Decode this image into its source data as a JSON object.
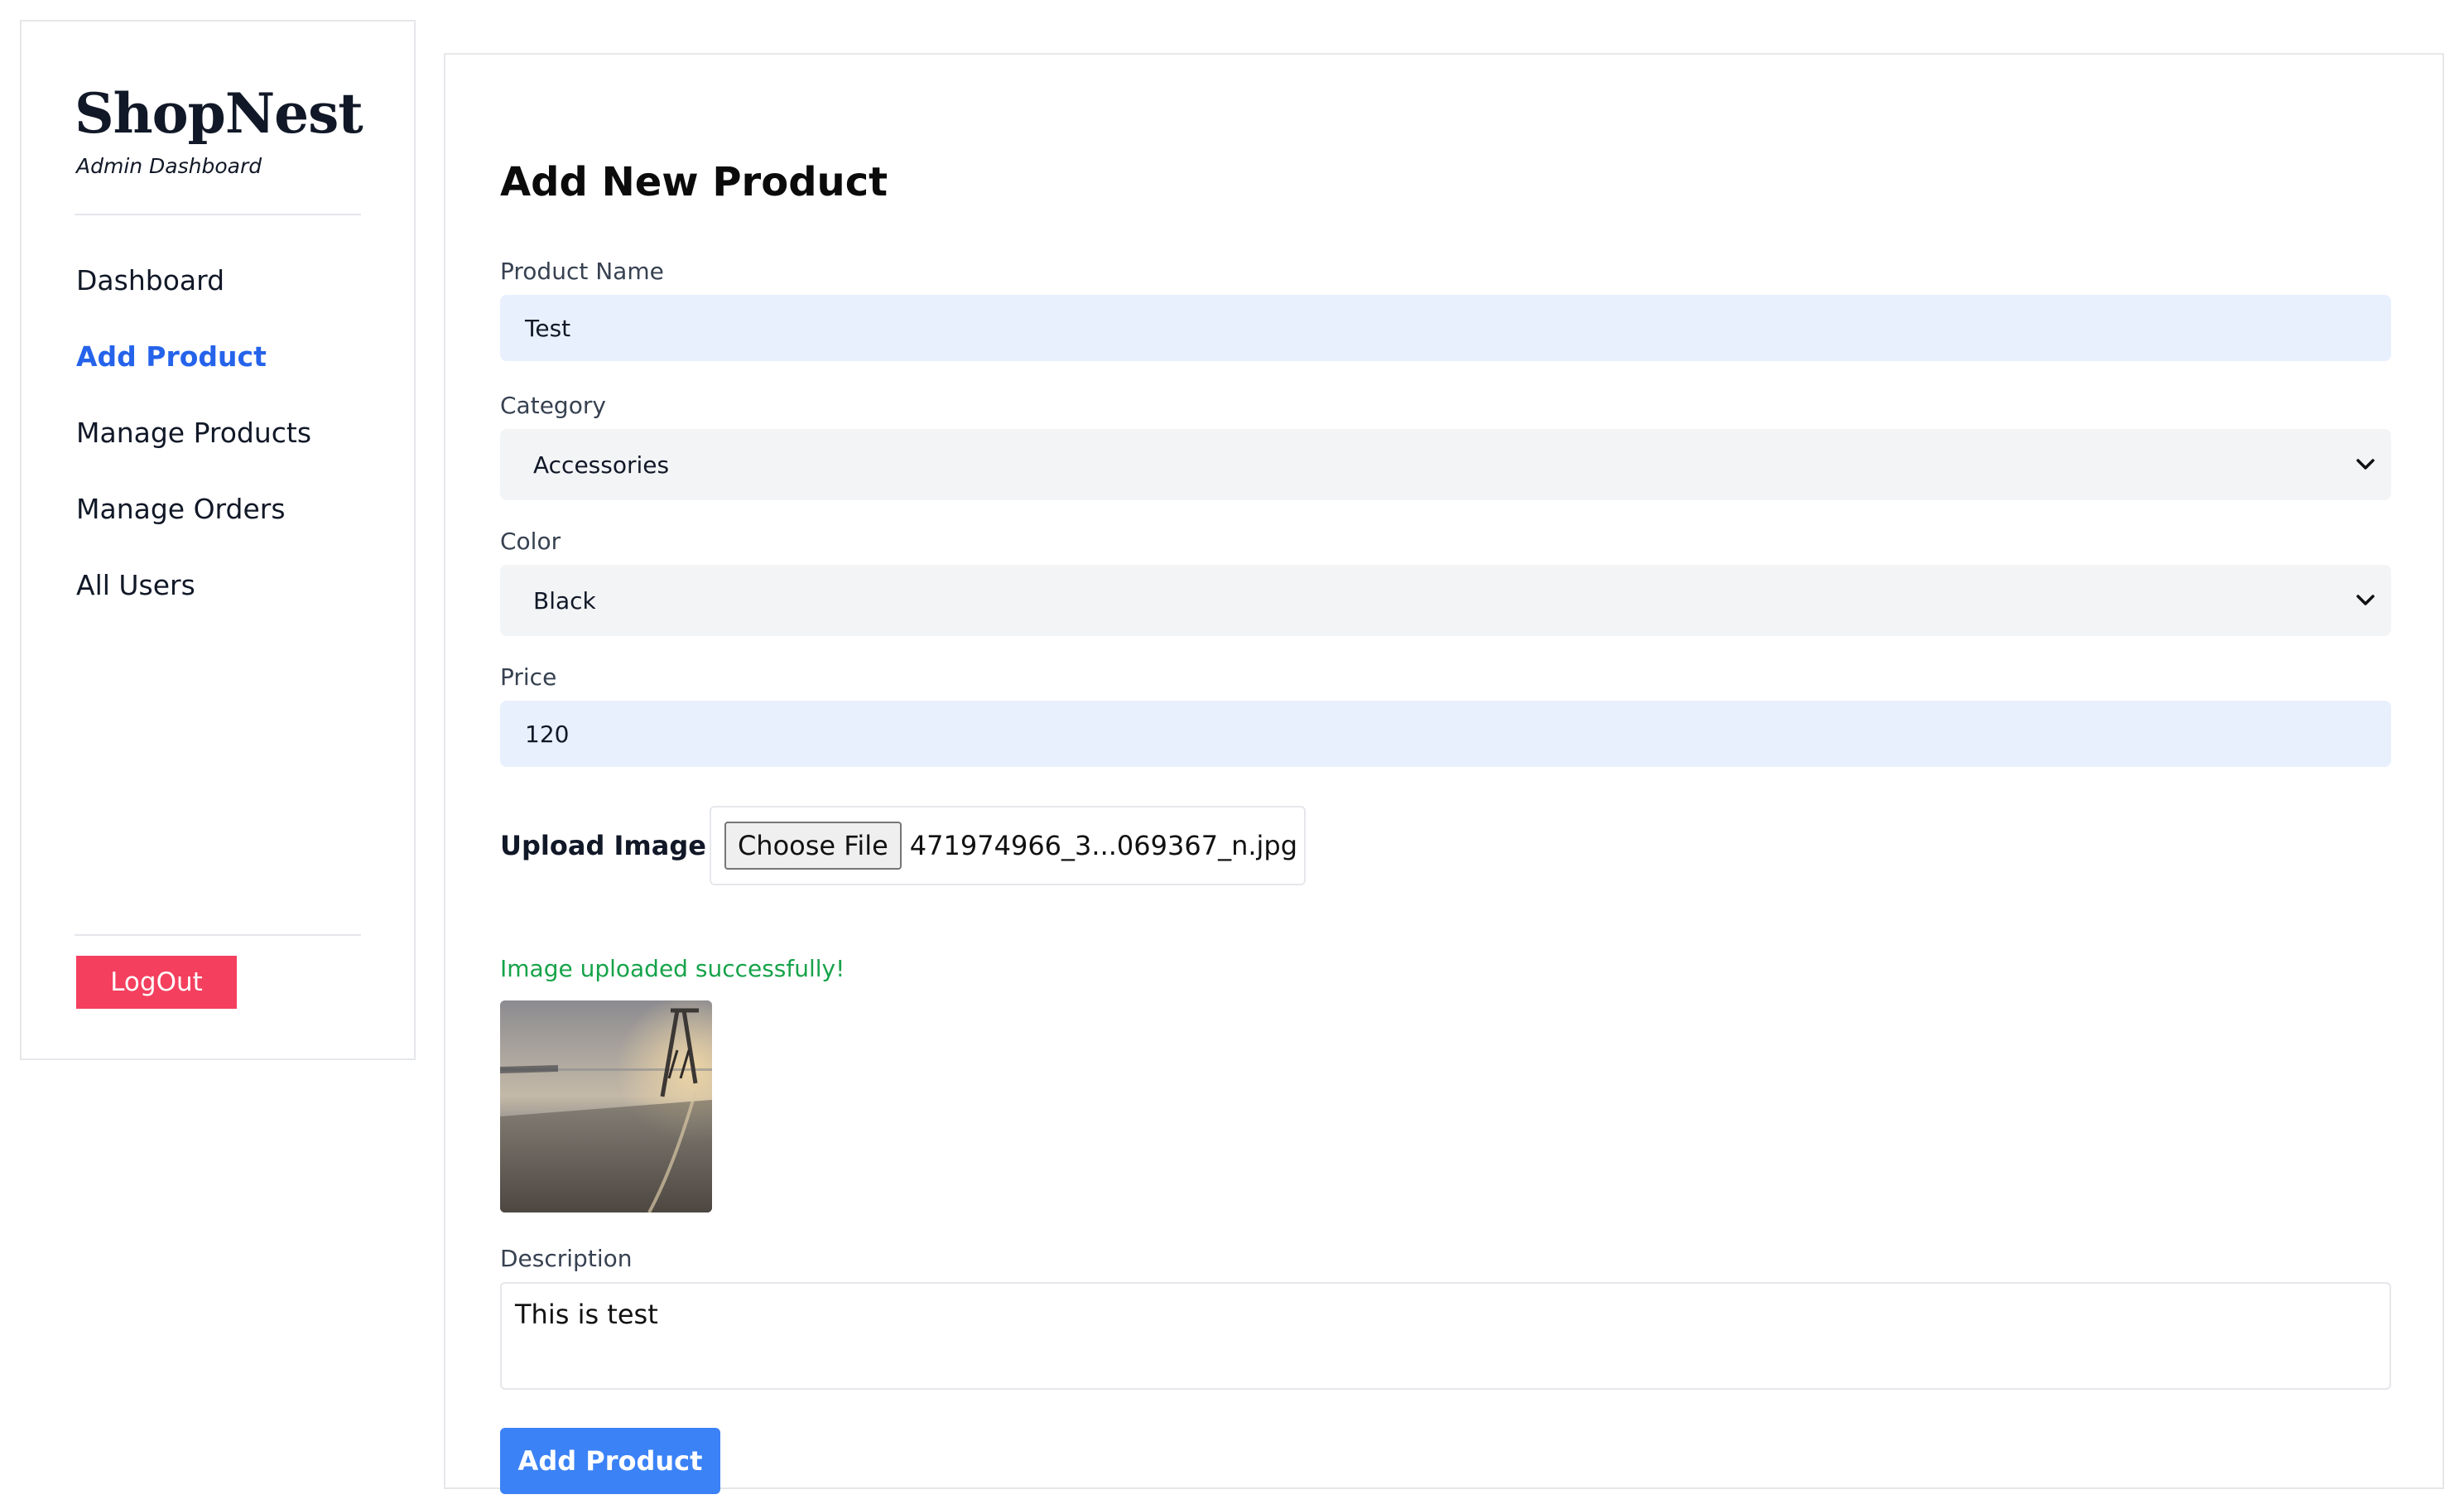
{
  "sidebar": {
    "brand": "ShopNest",
    "subtitle": "Admin Dashboard",
    "nav": [
      {
        "label": "Dashboard",
        "active": false
      },
      {
        "label": "Add Product",
        "active": true
      },
      {
        "label": "Manage Products",
        "active": false
      },
      {
        "label": "Manage Orders",
        "active": false
      },
      {
        "label": "All Users",
        "active": false
      }
    ],
    "logout_label": "LogOut"
  },
  "form": {
    "title": "Add New Product",
    "product_name": {
      "label": "Product Name",
      "value": "Test"
    },
    "category": {
      "label": "Category",
      "value": "Accessories"
    },
    "color": {
      "label": "Color",
      "value": "Black"
    },
    "price": {
      "label": "Price",
      "value": "120"
    },
    "upload": {
      "label": "Upload Image",
      "button_label": "Choose File",
      "file_name": "471974966_3...069367_n.jpg",
      "status": "Image uploaded successfully!"
    },
    "description": {
      "label": "Description",
      "value": "This is test"
    },
    "submit_label": "Add Product"
  },
  "colors": {
    "accent": "#2563eb",
    "logout": "#f43f5e",
    "submit": "#3b82f6",
    "success": "#16a34a",
    "input_bg": "#e8f0fe",
    "select_bg": "#f3f4f6"
  }
}
